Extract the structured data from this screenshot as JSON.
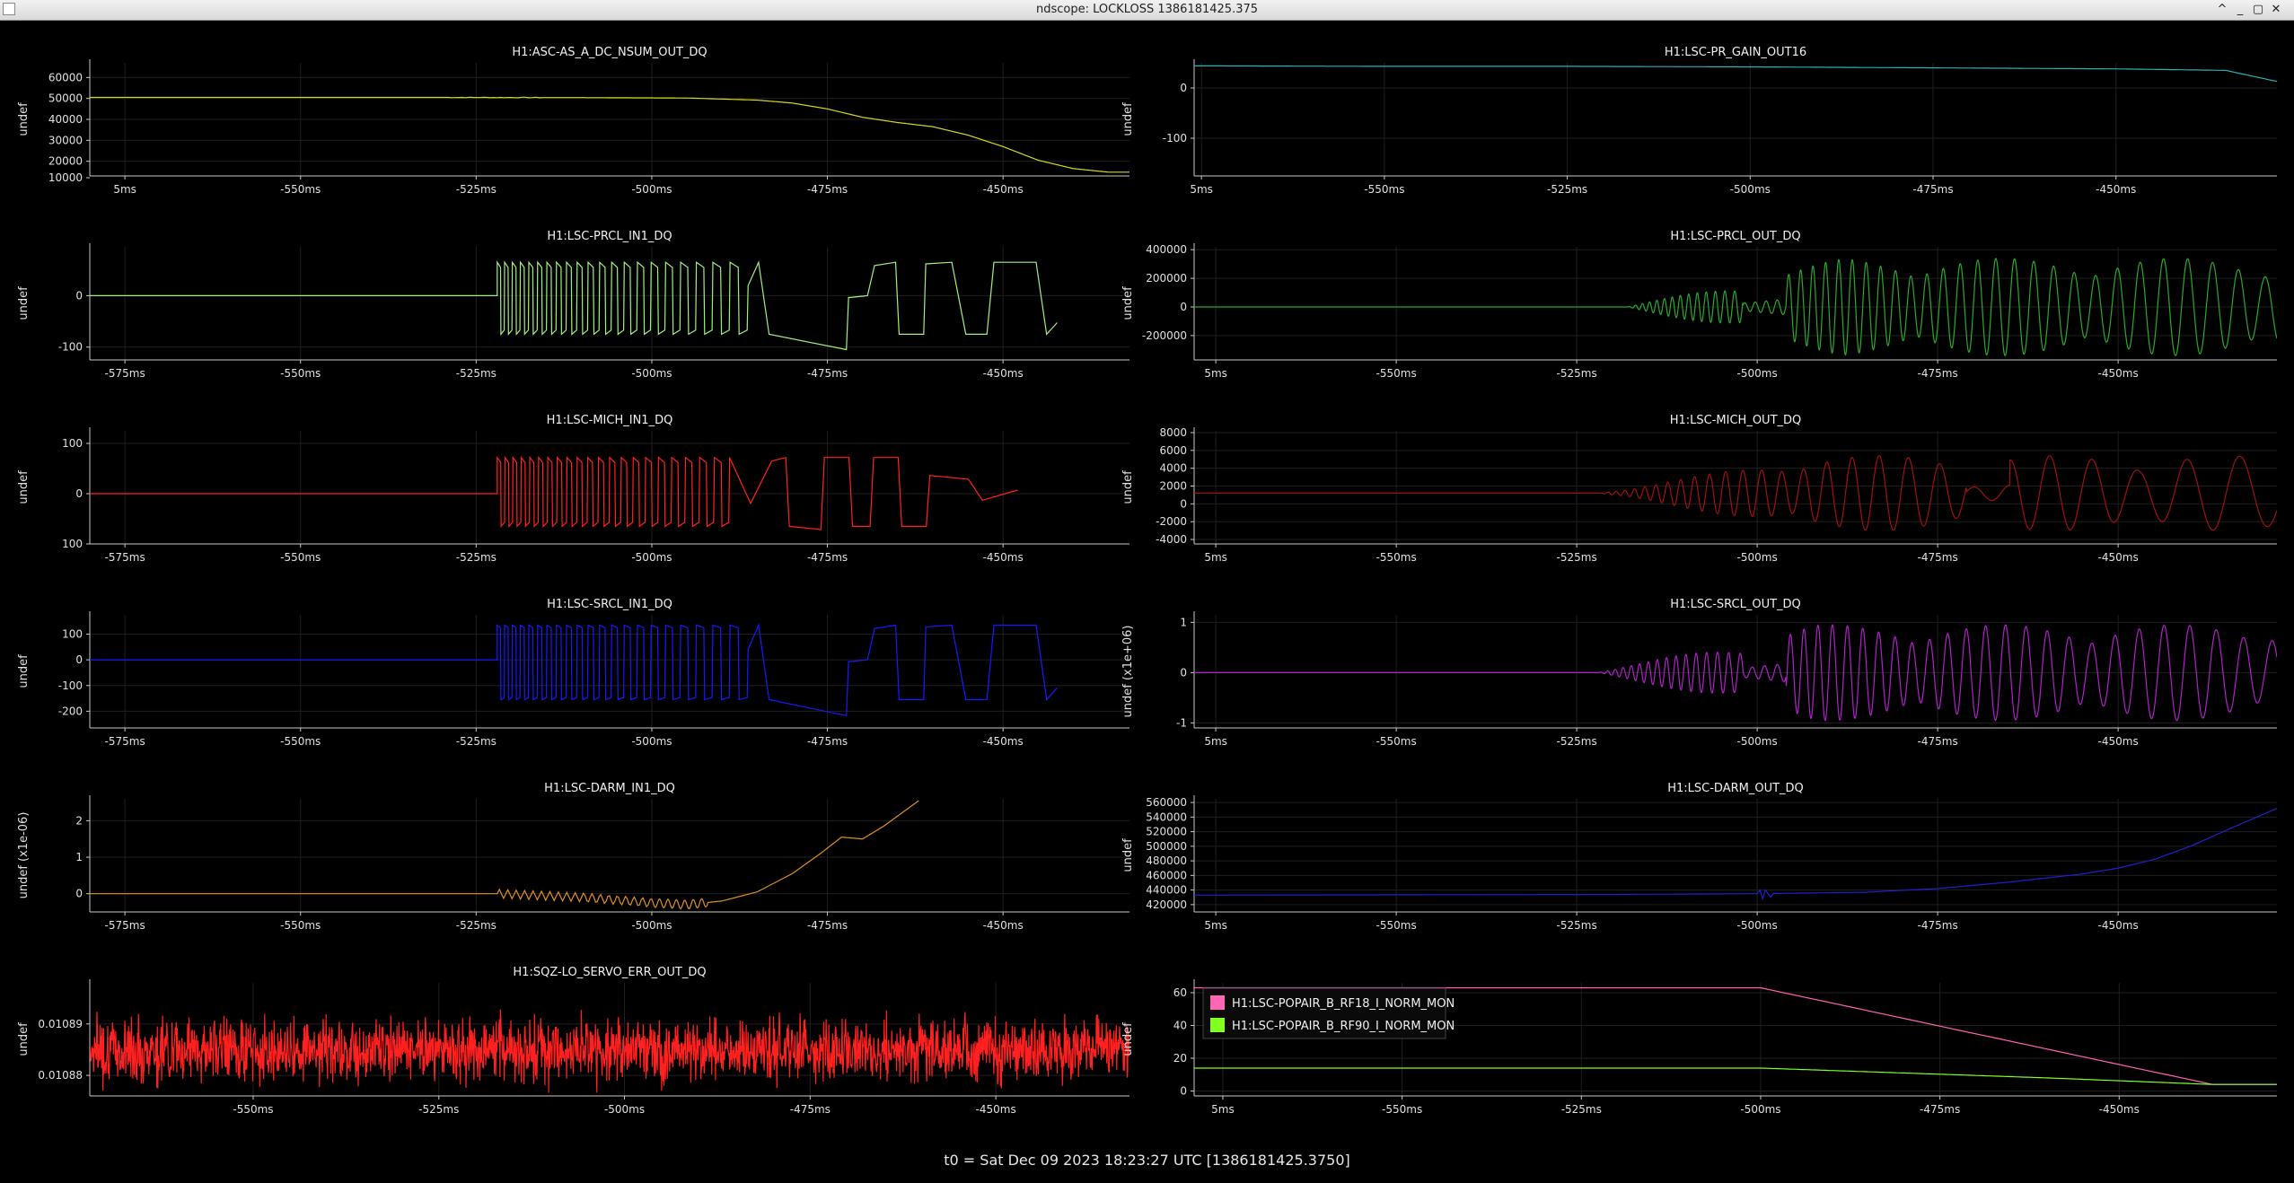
{
  "window": {
    "title": "ndscope: LOCKLOSS 1386181425.375",
    "app_icon": "ndscope-app-icon",
    "buttons": [
      "chevron-up-icon",
      "minimize-icon",
      "maximize-icon",
      "close-icon"
    ],
    "button_glyphs": [
      "^",
      "_",
      "▢",
      "✕"
    ]
  },
  "footer": {
    "t0": "t0 = Sat Dec 09 2023 18:23:27 UTC [1386181425.3750]"
  },
  "colors": {
    "background": "#000000",
    "grid": "#1f1f1f",
    "axis": "#c8c8c8",
    "yellow": "#d8d820",
    "teal": "#2ab0b5",
    "lightgreen": "#a0f080",
    "green": "#2aa82a",
    "red": "#ff2020",
    "darkred": "#a01010",
    "blue": "#1818ff",
    "purple": "#b020c8",
    "orange": "#e09020",
    "navy": "#2020d0",
    "pink": "#ff66b3",
    "lime": "#80ff20"
  },
  "chart_data": [
    {
      "id": "asc-as-a-dc",
      "type": "line",
      "title": "H1:ASC-AS_A_DC_NSUM_OUT_DQ",
      "ylabel": "undef",
      "color": "yellow",
      "ylim": [
        13000,
        67000
      ],
      "yticks": [
        10000,
        20000,
        30000,
        40000,
        50000,
        60000
      ],
      "ytick_labels": [
        "10000",
        "20000",
        "30000",
        "40000",
        "50000",
        "60000"
      ],
      "xlim": [
        -580,
        -432
      ],
      "xticks": [
        -575,
        -550,
        -525,
        -500,
        -475,
        -450
      ],
      "xtick_labels": [
        "5ms",
        "-550ms",
        "-525ms",
        "-500ms",
        "-475ms",
        "-450ms"
      ],
      "series": [
        {
          "x": [
            -580,
            -530,
            -510,
            -495,
            -485,
            -480,
            -475,
            -470,
            -465,
            -460,
            -455,
            -450,
            -445,
            -440,
            -435,
            -432
          ],
          "y": [
            50500,
            50500,
            50400,
            50200,
            49200,
            47800,
            45000,
            41000,
            38500,
            36500,
            32500,
            27000,
            20500,
            16500,
            14800,
            14800
          ],
          "noise": 300
        }
      ]
    },
    {
      "id": "pr-gain",
      "type": "line",
      "title": "H1:LSC-PR_GAIN_OUT16",
      "ylabel": "undef",
      "color": "teal",
      "ylim": [
        -175,
        50
      ],
      "yticks": [
        0,
        -100
      ],
      "ytick_labels": [
        "0",
        "-100"
      ],
      "xlim": [
        -576,
        -428
      ],
      "xticks": [
        -575,
        -550,
        -525,
        -500,
        -475,
        -450
      ],
      "xtick_labels": [
        "5ms",
        "-550ms",
        "-525ms",
        "-500ms",
        "-475ms",
        "-450ms"
      ],
      "series": [
        {
          "x": [
            -576,
            -550,
            -525,
            -500,
            -475,
            -450,
            -435,
            -428
          ],
          "y": [
            44,
            43,
            43,
            42,
            40,
            38,
            35,
            13
          ]
        }
      ]
    },
    {
      "id": "prcl-in1",
      "type": "line",
      "title": "H1:LSC-PRCL_IN1_DQ",
      "ylabel": "undef",
      "color": "lightgreen",
      "ylim": [
        -125,
        95
      ],
      "yticks": [
        0,
        -100
      ],
      "ytick_labels": [
        "0",
        "-100"
      ],
      "xlim": [
        -580,
        -432
      ],
      "xticks": [
        -575,
        -550,
        -525,
        -500,
        -475,
        -450
      ],
      "xtick_labels": [
        "-575ms",
        "-550ms",
        "-525ms",
        "-500ms",
        "-475ms",
        "-450ms"
      ],
      "series": [
        {
          "osc": {
            "x0": -580,
            "x1": -432,
            "flat": 0,
            "t_start": -522,
            "t_sq_end": -488,
            "amp_hi": 65,
            "amp_lo": -75,
            "period_start": 1.05,
            "period_end": 2.6,
            "post": "slow"
          }
        }
      ]
    },
    {
      "id": "prcl-out",
      "type": "line",
      "title": "H1:LSC-PRCL_OUT_DQ",
      "ylabel": "undef",
      "color": "green",
      "ylim": [
        -370000,
        420000
      ],
      "yticks": [
        -200000,
        0,
        200000,
        400000
      ],
      "ytick_labels": [
        "-200000",
        "0",
        "200000",
        "400000"
      ],
      "xlim": [
        -578,
        -428
      ],
      "xticks": [
        -575,
        -550,
        -525,
        -500,
        -475,
        -450
      ],
      "xtick_labels": [
        "5ms",
        "-550ms",
        "-525ms",
        "-500ms",
        "-475ms",
        "-450ms"
      ],
      "series": [
        {
          "wave": {
            "x0": -578,
            "x1": -428,
            "t_start": -518,
            "amp": 340000,
            "period_start": 0.9,
            "period_end": 3.8,
            "peak_at": -490
          }
        }
      ]
    },
    {
      "id": "mich-in1",
      "type": "line",
      "title": "H1:LSC-MICH_IN1_DQ",
      "ylabel": "undef",
      "color": "red",
      "ylim": [
        -100,
        125
      ],
      "yticks": [
        100,
        0,
        -100
      ],
      "ytick_labels": [
        "100",
        "0",
        "100"
      ],
      "xlim": [
        -580,
        -432
      ],
      "xticks": [
        -575,
        -550,
        -525,
        -500,
        -475,
        -450
      ],
      "xtick_labels": [
        "-575ms",
        "-550ms",
        "-525ms",
        "-500ms",
        "-475ms",
        "-450ms"
      ],
      "series": [
        {
          "osc": {
            "x0": -580,
            "x1": -432,
            "flat": 0,
            "t_start": -522,
            "t_sq_end": -490,
            "amp_hi": 72,
            "amp_lo": -65,
            "period_start": 1.1,
            "period_end": 2.2,
            "post": "square"
          }
        }
      ]
    },
    {
      "id": "mich-out",
      "type": "line",
      "title": "H1:LSC-MICH_OUT_DQ",
      "ylabel": "undef",
      "color": "darkred",
      "ylim": [
        -4500,
        8200
      ],
      "yticks": [
        -4000,
        -2000,
        0,
        2000,
        4000,
        6000,
        8000
      ],
      "ytick_labels": [
        "-4000",
        "-2000",
        "0",
        "2000",
        "4000",
        "6000",
        "8000"
      ],
      "xlim": [
        -578,
        -428
      ],
      "xticks": [
        -575,
        -550,
        -525,
        -500,
        -475,
        -450
      ],
      "xtick_labels": [
        "5ms",
        "-550ms",
        "-525ms",
        "-500ms",
        "-475ms",
        "-450ms"
      ],
      "series": [
        {
          "wave": {
            "x0": -578,
            "x1": -428,
            "t_start": -522,
            "amp": 4200,
            "period_start": 1.0,
            "period_end": 8.0,
            "offset": 1200,
            "peak_at": -459,
            "grow": true
          }
        }
      ]
    },
    {
      "id": "srcl-in1",
      "type": "line",
      "title": "H1:LSC-SRCL_IN1_DQ",
      "ylabel": "undef",
      "color": "blue",
      "ylim": [
        -265,
        175
      ],
      "yticks": [
        100,
        0,
        -100,
        -200
      ],
      "ytick_labels": [
        "100",
        "0",
        "-100",
        "-200"
      ],
      "xlim": [
        -580,
        -432
      ],
      "xticks": [
        -575,
        -550,
        -525,
        -500,
        -475,
        -450
      ],
      "xtick_labels": [
        "-575ms",
        "-550ms",
        "-525ms",
        "-500ms",
        "-475ms",
        "-450ms"
      ],
      "series": [
        {
          "osc": {
            "x0": -580,
            "x1": -432,
            "flat": 0,
            "t_start": -522,
            "t_sq_end": -488,
            "amp_hi": 135,
            "amp_lo": -155,
            "period_start": 1.05,
            "period_end": 2.6,
            "post": "slowlow"
          }
        }
      ]
    },
    {
      "id": "srcl-out",
      "type": "line",
      "title": "H1:LSC-SRCL_OUT_DQ",
      "ylabel": "undef (x1e+06)",
      "color": "purple",
      "ylim": [
        -1.1,
        1.15
      ],
      "yticks": [
        1,
        0,
        -1
      ],
      "ytick_labels": [
        "1",
        "0",
        "-1"
      ],
      "xlim": [
        -578,
        -428
      ],
      "xticks": [
        -575,
        -550,
        -525,
        -500,
        -475,
        -450
      ],
      "xtick_labels": [
        "5ms",
        "-550ms",
        "-525ms",
        "-500ms",
        "-475ms",
        "-450ms"
      ],
      "series": [
        {
          "wave": {
            "x0": -578,
            "x1": -428,
            "t_start": -522,
            "amp": 0.95,
            "period_start": 1.0,
            "period_end": 4.0,
            "peak_at": -490
          }
        }
      ]
    },
    {
      "id": "darm-in1",
      "type": "line",
      "title": "H1:LSC-DARM_IN1_DQ",
      "ylabel": "undef (x1e-06)",
      "color": "orange",
      "ylim": [
        -0.5,
        2.6
      ],
      "yticks": [
        0,
        1,
        2
      ],
      "ytick_labels": [
        "0",
        "1",
        "2"
      ],
      "xlim": [
        -580,
        -432
      ],
      "xticks": [
        -575,
        -550,
        -525,
        -500,
        -475,
        -450
      ],
      "xtick_labels": [
        "-575ms",
        "-550ms",
        "-525ms",
        "-500ms",
        "-475ms",
        "-450ms"
      ],
      "series": [
        {
          "x": [
            -580,
            -522,
            -510,
            -500,
            -495,
            -490,
            -485,
            -480,
            -476,
            -473,
            -470,
            -467,
            -462
          ],
          "y": [
            0,
            0,
            -0.1,
            -0.25,
            -0.3,
            -0.2,
            0.05,
            0.55,
            1.1,
            1.55,
            1.5,
            1.85,
            2.55
          ],
          "ripple": {
            "from": -522,
            "to": -492,
            "amp": 0.12,
            "period": 1.2
          }
        }
      ]
    },
    {
      "id": "darm-out",
      "type": "line",
      "title": "H1:LSC-DARM_OUT_DQ",
      "ylabel": "undef",
      "color": "navy",
      "ylim": [
        410000,
        565000
      ],
      "yticks": [
        420000,
        440000,
        460000,
        480000,
        500000,
        520000,
        540000,
        560000
      ],
      "ytick_labels": [
        "420000",
        "440000",
        "460000",
        "480000",
        "500000",
        "520000",
        "540000",
        "560000"
      ],
      "xlim": [
        -578,
        -428
      ],
      "xticks": [
        -575,
        -550,
        -525,
        -500,
        -475,
        -450
      ],
      "xtick_labels": [
        "5ms",
        "-550ms",
        "-525ms",
        "-500ms",
        "-475ms",
        "-450ms"
      ],
      "series": [
        {
          "x": [
            -578,
            -520,
            -500,
            -485,
            -475,
            -465,
            -455,
            -450,
            -445,
            -440,
            -435,
            -428
          ],
          "y": [
            433000,
            434000,
            435000,
            437000,
            442000,
            451000,
            462000,
            470000,
            482000,
            500000,
            522000,
            552000
          ],
          "ripple": {
            "from": -520,
            "to": -498,
            "amp": 7000,
            "period": 1.0
          }
        }
      ]
    },
    {
      "id": "sqz-lo",
      "type": "line",
      "title": "H1:SQZ-LO_SERVO_ERR_OUT_DQ",
      "ylabel": "undef",
      "color": "red",
      "ylim": [
        0.010876,
        0.010898
      ],
      "yticks": [
        0.01088,
        0.01089
      ],
      "ytick_labels": [
        "0.01088",
        "0.01089"
      ],
      "xlim": [
        -572,
        -432
      ],
      "xticks": [
        -550,
        -525,
        -500,
        -475,
        -450
      ],
      "xtick_labels": [
        "-550ms",
        "-525ms",
        "-500ms",
        "-475ms",
        "-450ms"
      ],
      "series": [
        {
          "noise_band": {
            "x0": -572,
            "x1": -432,
            "mid": 0.010885,
            "amp": 5.5e-06
          }
        }
      ]
    },
    {
      "id": "popair",
      "type": "line",
      "title": "",
      "ylabel": "undef",
      "ylim": [
        -3,
        66
      ],
      "yticks": [
        0,
        20,
        40,
        60
      ],
      "ytick_labels": [
        "0",
        "20",
        "40",
        "60"
      ],
      "xlim": [
        -579,
        -428
      ],
      "xticks": [
        -575,
        -550,
        -525,
        -500,
        -475,
        -450
      ],
      "xtick_labels": [
        "5ms",
        "-550ms",
        "-525ms",
        "-500ms",
        "-475ms",
        "-450ms"
      ],
      "legend": "top-left",
      "series": [
        {
          "name": "H1:LSC-POPAIR_B_RF18_I_NORM_MON",
          "color": "pink",
          "x": [
            -579,
            -500,
            -437,
            -428
          ],
          "y": [
            63,
            63,
            4,
            4
          ]
        },
        {
          "name": "H1:LSC-POPAIR_B_RF90_I_NORM_MON",
          "color": "lime",
          "x": [
            -579,
            -500,
            -480,
            -460,
            -437,
            -428
          ],
          "y": [
            14,
            14,
            11,
            8,
            4,
            4
          ]
        }
      ]
    }
  ]
}
